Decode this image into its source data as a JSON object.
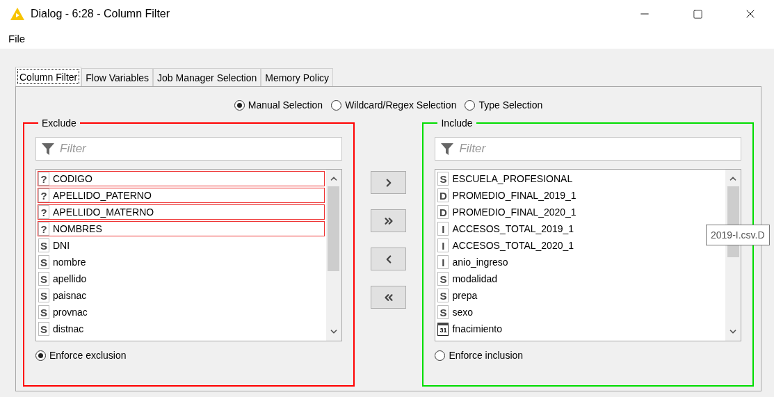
{
  "window": {
    "title": "Dialog - 6:28 - Column Filter"
  },
  "menu": [
    "File"
  ],
  "tabs": [
    {
      "label": "Column Filter",
      "selected": true
    },
    {
      "label": "Flow Variables",
      "selected": false
    },
    {
      "label": "Job Manager Selection",
      "selected": false
    },
    {
      "label": "Memory Policy",
      "selected": false
    }
  ],
  "selection_modes": [
    {
      "label": "Manual Selection",
      "selected": true
    },
    {
      "label": "Wildcard/Regex Selection",
      "selected": false
    },
    {
      "label": "Type Selection",
      "selected": false
    }
  ],
  "exclude": {
    "title": "Exclude",
    "color": "#ff0000",
    "filter": {
      "placeholder": "Filter"
    },
    "items": [
      {
        "kind": "letter",
        "badge": "?",
        "name": "CODIGO",
        "invalid": true
      },
      {
        "kind": "letter",
        "badge": "?",
        "name": "APELLIDO_PATERNO",
        "invalid": true
      },
      {
        "kind": "letter",
        "badge": "?",
        "name": "APELLIDO_MATERNO",
        "invalid": true
      },
      {
        "kind": "letter",
        "badge": "?",
        "name": "NOMBRES",
        "invalid": true
      },
      {
        "kind": "letter",
        "badge": "S",
        "name": "DNI",
        "invalid": false
      },
      {
        "kind": "letter",
        "badge": "S",
        "name": "nombre",
        "invalid": false
      },
      {
        "kind": "letter",
        "badge": "S",
        "name": "apellido",
        "invalid": false
      },
      {
        "kind": "letter",
        "badge": "S",
        "name": "paisnac",
        "invalid": false
      },
      {
        "kind": "letter",
        "badge": "S",
        "name": "provnac",
        "invalid": false
      },
      {
        "kind": "letter",
        "badge": "S",
        "name": "distnac",
        "invalid": false
      }
    ],
    "enforce": {
      "label": "Enforce exclusion",
      "selected": true
    }
  },
  "include": {
    "title": "Include",
    "color": "#00dd00",
    "filter": {
      "placeholder": "Filter"
    },
    "items": [
      {
        "kind": "letter",
        "badge": "S",
        "name": "ESCUELA_PROFESIONAL",
        "invalid": false
      },
      {
        "kind": "letter",
        "badge": "D",
        "name": "PROMEDIO_FINAL_2019_1",
        "invalid": false
      },
      {
        "kind": "letter",
        "badge": "D",
        "name": "PROMEDIO_FINAL_2020_1",
        "invalid": false
      },
      {
        "kind": "letter",
        "badge": "I",
        "name": "ACCESOS_TOTAL_2019_1",
        "invalid": false
      },
      {
        "kind": "letter",
        "badge": "I",
        "name": "ACCESOS_TOTAL_2020_1",
        "invalid": false
      },
      {
        "kind": "letter",
        "badge": "I",
        "name": "anio_ingreso",
        "invalid": false
      },
      {
        "kind": "letter",
        "badge": "S",
        "name": "modalidad",
        "invalid": false
      },
      {
        "kind": "letter",
        "badge": "S",
        "name": "prepa",
        "invalid": false
      },
      {
        "kind": "letter",
        "badge": "S",
        "name": "sexo",
        "invalid": false
      },
      {
        "kind": "date",
        "badge": "31",
        "name": "fnacimiento",
        "invalid": false
      }
    ],
    "enforce": {
      "label": "Enforce inclusion",
      "selected": false
    }
  },
  "tooltip": {
    "text": "2019-I.csv.D"
  }
}
